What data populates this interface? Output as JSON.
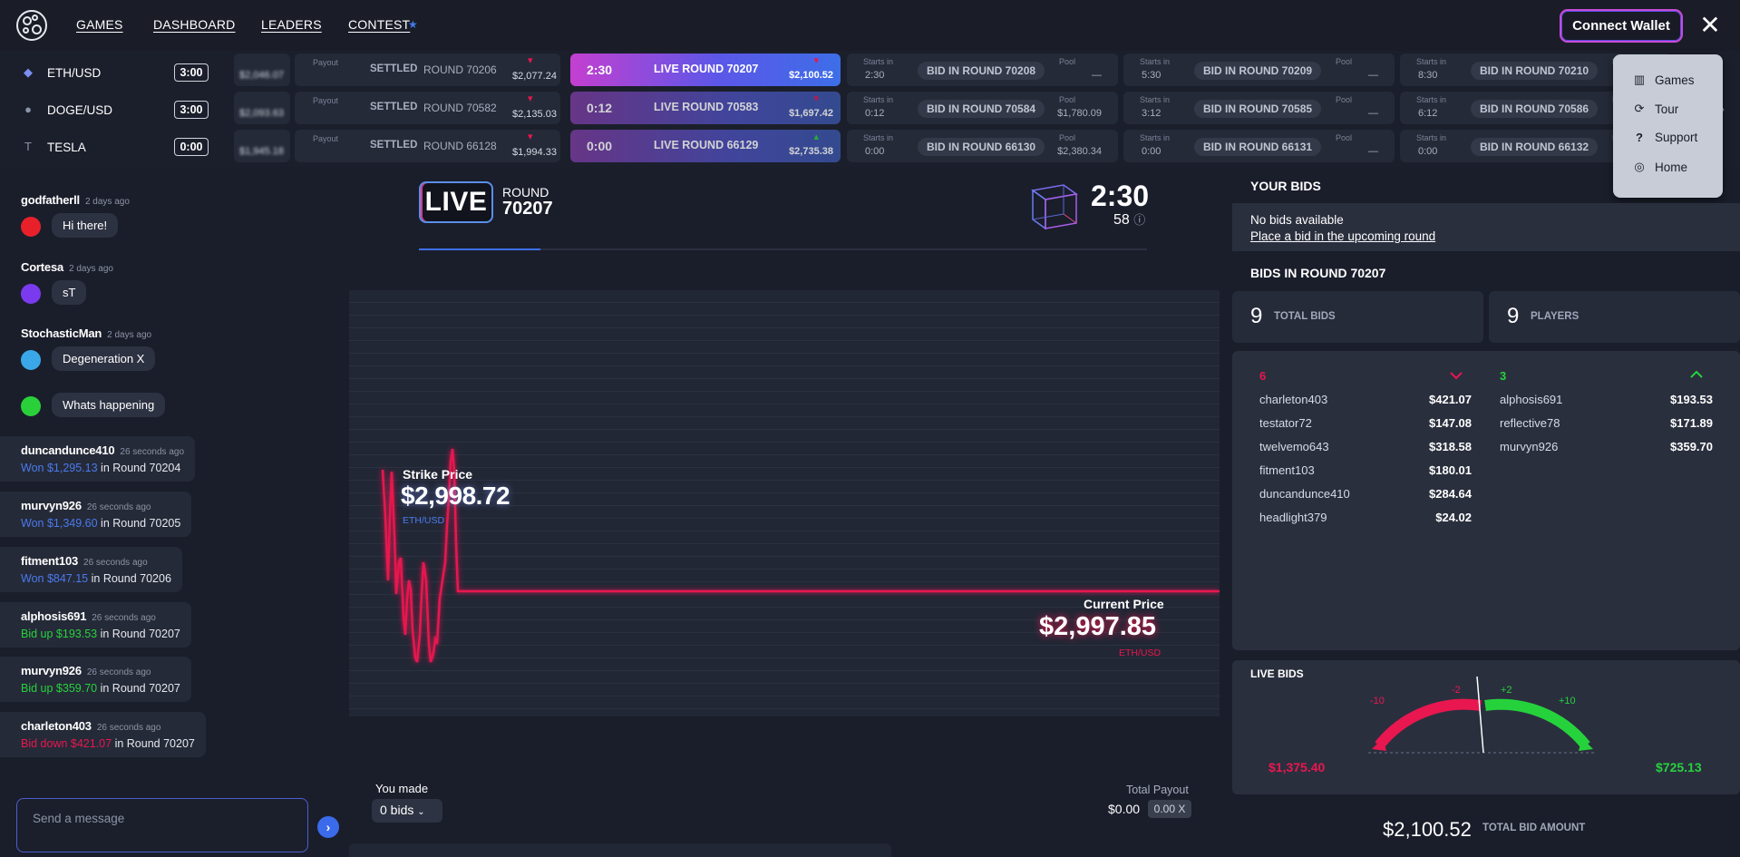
{
  "nav": {
    "links": [
      "GAMES",
      "DASHBOARD",
      "LEADERS",
      "CONTEST"
    ],
    "connect_wallet": "Connect Wallet",
    "close": "✕"
  },
  "menu": {
    "items": [
      {
        "label": "Games",
        "icon": "map-icon"
      },
      {
        "label": "Tour",
        "icon": "tour-icon"
      },
      {
        "label": "Support",
        "icon": "question-icon"
      },
      {
        "label": "Home",
        "icon": "home-icon"
      }
    ]
  },
  "assets": [
    {
      "name": "ETH/USD",
      "time": "3:00",
      "icon": "eth-icon"
    },
    {
      "name": "DOGE/USD",
      "time": "3:00",
      "icon": "doge-icon"
    },
    {
      "name": "TESLA",
      "time": "0:00",
      "icon": "tesla-icon"
    }
  ],
  "ticker": {
    "payout_label": "Payout",
    "settled_label": "SETTLED",
    "live_label": "LIVE",
    "bid_in_label": "BID IN",
    "pool_label": "Pool",
    "starts_in_label": "Starts in",
    "rows": [
      {
        "blurred_price": "$2,046.07",
        "settled_round": "ROUND 70206",
        "settled_price": "$2,077.24",
        "settled_dir": "down",
        "live_time": "2:30",
        "live_round": "ROUND 70207",
        "live_price": "$2,100.52",
        "live_dir": "down",
        "next": [
          {
            "starts": "2:30",
            "round": "ROUND 70208",
            "pool": "—"
          },
          {
            "starts": "5:30",
            "round": "ROUND 70209",
            "pool": "—"
          },
          {
            "starts": "8:30",
            "round": "ROUND 70210",
            "pool": "—"
          }
        ]
      },
      {
        "blurred_price": "$2,093.63",
        "settled_round": "ROUND 70582",
        "settled_price": "$2,135.03",
        "settled_dir": "down",
        "live_time": "0:12",
        "live_round": "ROUND 70583",
        "live_price": "$1,697.42",
        "live_dir": "down",
        "next": [
          {
            "starts": "0:12",
            "round": "ROUND 70584",
            "pool": "$1,780.09"
          },
          {
            "starts": "3:12",
            "round": "ROUND 70585",
            "pool": "—"
          },
          {
            "starts": "6:12",
            "round": "ROUND 70586",
            "pool": "—"
          }
        ]
      },
      {
        "blurred_price": "$1,945.18",
        "settled_round": "ROUND 66128",
        "settled_price": "$1,994.33",
        "settled_dir": "down",
        "live_time": "0:00",
        "live_round": "ROUND 66129",
        "live_price": "$2,735.38",
        "live_dir": "up",
        "next": [
          {
            "starts": "0:00",
            "round": "ROUND 66130",
            "pool": "$2,380.34"
          },
          {
            "starts": "0:00",
            "round": "ROUND 66131",
            "pool": "—"
          },
          {
            "starts": "0:00",
            "round": "ROUND 66132",
            "pool": "—"
          }
        ]
      }
    ]
  },
  "chat": {
    "messages": [
      {
        "user": "godfatherll",
        "ago": "2 days ago",
        "text": "Hi there!",
        "avatar_color": "#e8202a"
      },
      {
        "user": "Cortesa",
        "ago": "2 days ago",
        "text": "sT",
        "avatar_color": "#7a3bef"
      },
      {
        "user": "StochasticMan",
        "ago": "2 days ago",
        "text": "Degeneration X",
        "avatar_color": "#3aa8e8"
      },
      {
        "user": "",
        "ago": "",
        "text": "Whats happening",
        "avatar_color": "#2ad03a"
      }
    ],
    "events": [
      {
        "user": "duncandunce410",
        "ago": "26 seconds ago",
        "action": "Won $1,295.13",
        "round": "in Round 70204",
        "kind": "won"
      },
      {
        "user": "murvyn926",
        "ago": "26 seconds ago",
        "action": "Won $1,349.60",
        "round": "in Round 70205",
        "kind": "won"
      },
      {
        "user": "fitment103",
        "ago": "26 seconds ago",
        "action": "Won $847.15",
        "round": "in Round 70206",
        "kind": "won"
      },
      {
        "user": "alphosis691",
        "ago": "26 seconds ago",
        "action": "Bid up $193.53",
        "round": "in Round 70207",
        "kind": "up"
      },
      {
        "user": "murvyn926",
        "ago": "26 seconds ago",
        "action": "Bid up $359.70",
        "round": "in Round 70207",
        "kind": "up"
      },
      {
        "user": "charleton403",
        "ago": "26 seconds ago",
        "action": "Bid down $421.07",
        "round": "in Round 70207",
        "kind": "down"
      }
    ],
    "placeholder": "Send a message"
  },
  "round": {
    "live_badge": "LIVE",
    "round_label": "ROUND",
    "round_number": "70207",
    "timer": "2:30",
    "sub_count": "58",
    "strike_label": "Strike Price",
    "strike_price": "$2,998.72",
    "strike_symbol": "ETH/USD",
    "current_label": "Current Price",
    "current_price": "$2,997.85",
    "current_symbol": "ETH/USD",
    "you_made_label": "You made",
    "bids_select": "0 bids",
    "total_payout_label": "Total Payout",
    "total_payout": "$0.00",
    "multiplier": "0.00 X"
  },
  "right": {
    "your_bids_title": "YOUR BIDS",
    "no_bids": "No bids available",
    "place_bid": "Place a bid in the upcoming round",
    "bids_in_round_title": "BIDS IN ROUND",
    "bids_in_round_num": "70207",
    "total_bids": "9",
    "total_bids_label": "TOTAL BIDS",
    "players": "9",
    "players_label": "PLAYERS",
    "down_count": "6",
    "up_count": "3",
    "down_bids": [
      {
        "user": "charleton403",
        "amount": "$421.07"
      },
      {
        "user": "testator72",
        "amount": "$147.08"
      },
      {
        "user": "twelvemo643",
        "amount": "$318.58"
      },
      {
        "user": "fitment103",
        "amount": "$180.01"
      },
      {
        "user": "duncandunce410",
        "amount": "$284.64"
      },
      {
        "user": "headlight379",
        "amount": "$24.02"
      }
    ],
    "up_bids": [
      {
        "user": "alphosis691",
        "amount": "$193.53"
      },
      {
        "user": "reflective78",
        "amount": "$171.89"
      },
      {
        "user": "murvyn926",
        "amount": "$359.70"
      }
    ],
    "live_bids_title": "LIVE BIDS",
    "gauge_labels": [
      "-10",
      "-2",
      "+2",
      "+10"
    ],
    "down_total": "$1,375.40",
    "up_total": "$725.13",
    "total_bid_amount": "$2,100.52",
    "total_bid_label": "TOTAL BID AMOUNT"
  },
  "colors": {
    "up": "#26d23c",
    "down": "#e8174f",
    "accent": "#3f6fe8"
  }
}
